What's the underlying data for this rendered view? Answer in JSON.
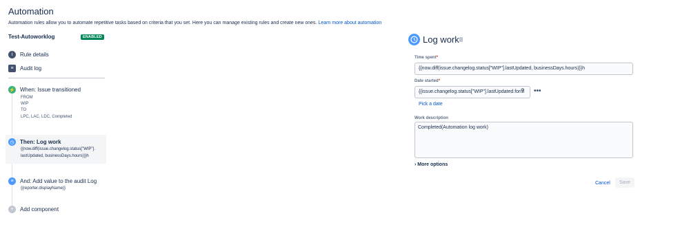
{
  "page": {
    "title": "Automation",
    "description": "Automation rules allow you to automate repetitive tasks based on criteria that you set. Here you can manage existing rules and create new ones. ",
    "learn_more": "Learn more about automation"
  },
  "rule": {
    "name": "Test-Autoworklog",
    "status": "ENABLED"
  },
  "sidebar": {
    "rule_details": "Rule details",
    "audit_log": "Audit log"
  },
  "components": {
    "when": {
      "title": "When: Issue transitioned",
      "from_label": "FROM",
      "from_value": "WIP",
      "to_label": "TO",
      "to_value": "LPC, LAC, LDC, Completed"
    },
    "then": {
      "title": "Then: Log work",
      "line1": "{{now.diff(issue.changelog.status[\"WIP\"].",
      "line2": "lastUpdated, businessDays.hours)}}h"
    },
    "and": {
      "title": "And: Add value to the audit Log",
      "line1": "{{reporter.displayName}}"
    },
    "add_component": "Add component"
  },
  "panel": {
    "title": "Log work",
    "time_spent_label": "Time spent",
    "time_spent_value": "{{now.diff(issue.changelog.status[\"WIP\"].lastUpdated, businessDays.hours)}}h",
    "date_started_label": "Date started",
    "date_started_value": "{{issue.changelog.status[\"WIP\"].lastUpdated.form",
    "help": "?",
    "more_dots": "•••",
    "pick_date": "Pick a date",
    "work_desc_label": "Work description",
    "work_desc_value": "Completed(Automation log work)",
    "more_options": "More options",
    "more_options_chevron": "›",
    "cancel": "Cancel",
    "save": "Save",
    "required_mark": "*"
  },
  "colors": {
    "enabled_badge": "#00875a",
    "when_icon": "#36b37e",
    "then_icon": "#4c9aff",
    "and_icon": "#4c9aff",
    "link": "#0052cc"
  },
  "icons": {
    "rule_details": "info-icon",
    "audit_log": "list-icon",
    "when": "lightning-icon",
    "then": "clock-icon",
    "and": "document-icon",
    "add": "plus-icon",
    "panel": "clock-icon",
    "trash": "trash-icon"
  }
}
